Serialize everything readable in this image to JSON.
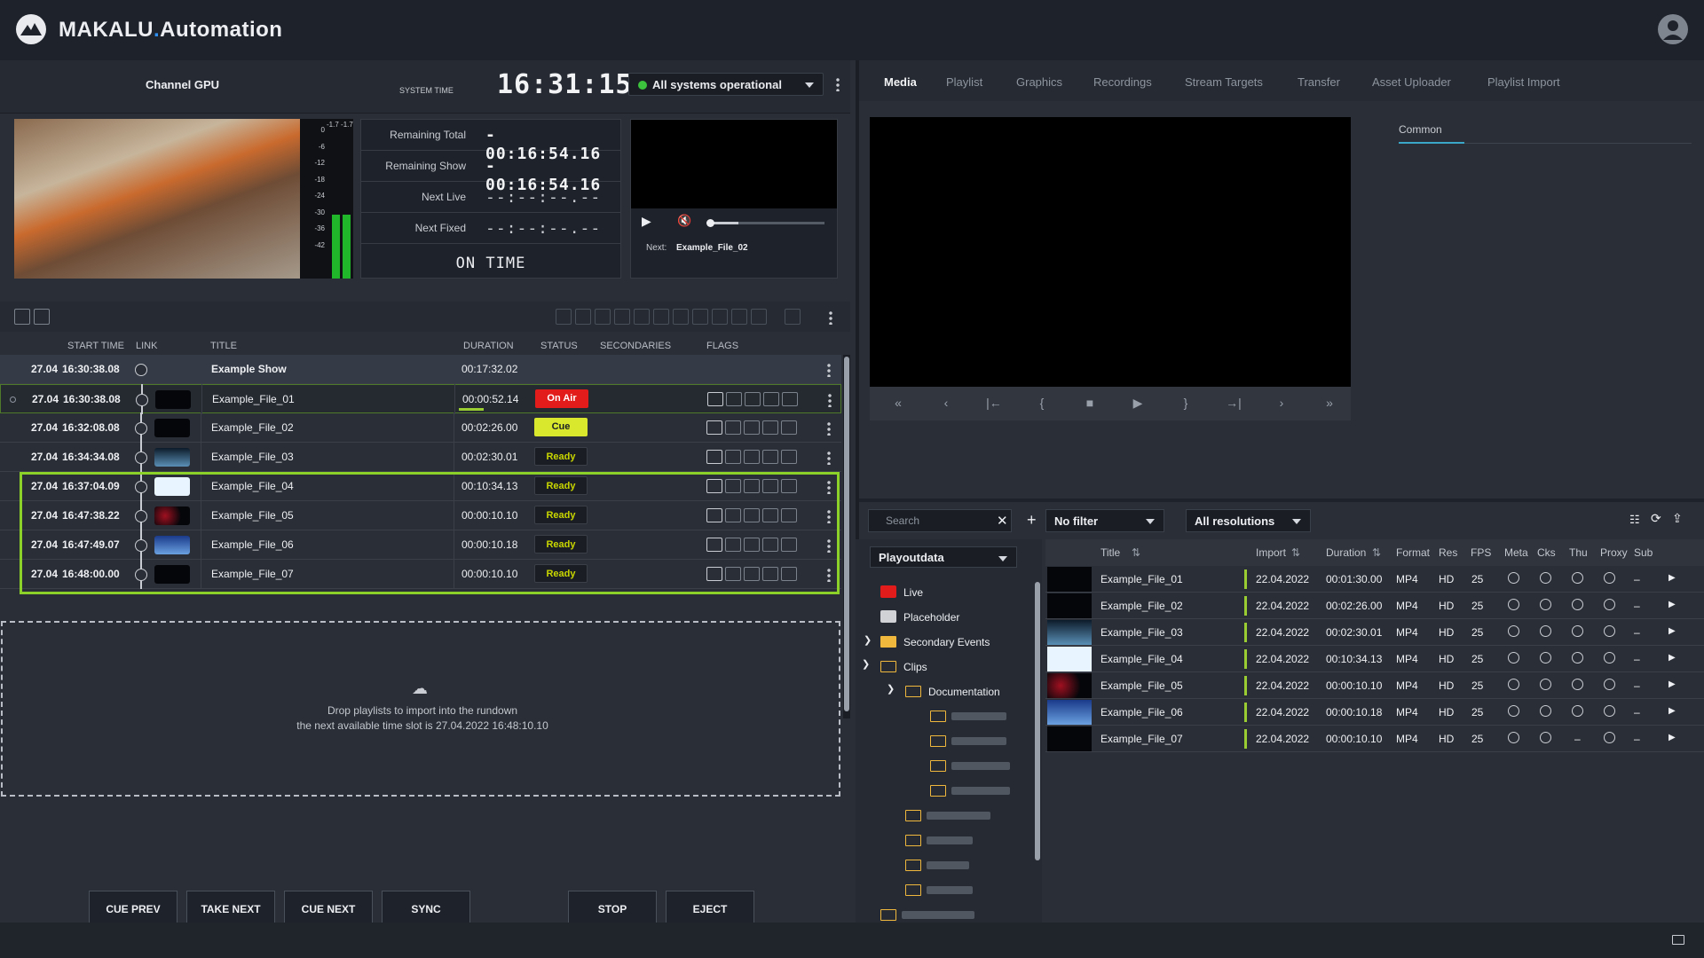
{
  "app": {
    "brand_main": "MAKALU",
    "brand_dot": ".",
    "brand_sub": "Automation"
  },
  "channel": {
    "name": "Channel GPU",
    "system_time_label": "SYSTEM TIME",
    "clock": "16:31:15",
    "status": "All systems operational",
    "status_color": "#3cc23c"
  },
  "vu": {
    "ticks": [
      "0",
      "-6",
      "-12",
      "-18",
      "-24",
      "-30",
      "-36",
      "-42"
    ],
    "peak_labels": [
      "-1.7",
      "-1.7"
    ],
    "levels": [
      0.4,
      0.4
    ]
  },
  "timers": {
    "rows": [
      {
        "label": "Remaining Total",
        "value": "- 00:16:54.16"
      },
      {
        "label": "Remaining Show",
        "value": "- 00:16:54.16"
      },
      {
        "label": "Next Live",
        "value": "--:--:--.--"
      },
      {
        "label": "Next Fixed",
        "value": "--:--:--.--"
      }
    ],
    "state": "ON TIME"
  },
  "preview": {
    "next_label": "Next:",
    "next_value": "Example_File_02",
    "progress": 0.25
  },
  "rundown": {
    "headers": {
      "start": "START TIME",
      "link": "LINK",
      "title": "TITLE",
      "duration": "DURATION",
      "status": "STATUS",
      "secondaries": "SECONDARIES",
      "flags": "FLAGS"
    },
    "show": {
      "date": "27.04",
      "time": "16:30:38.08",
      "title": "Example Show",
      "duration": "00:17:32.02"
    },
    "items": [
      {
        "date": "27.04",
        "time": "16:30:38.08",
        "title": "Example_File_01",
        "duration": "00:00:52.14",
        "status": "On Air",
        "kind": "onair"
      },
      {
        "date": "27.04",
        "time": "16:32:08.08",
        "title": "Example_File_02",
        "duration": "00:02:26.00",
        "status": "Cue",
        "kind": "cue"
      },
      {
        "date": "27.04",
        "time": "16:34:34.08",
        "title": "Example_File_03",
        "duration": "00:02:30.01",
        "status": "Ready",
        "kind": "ready"
      },
      {
        "date": "27.04",
        "time": "16:37:04.09",
        "title": "Example_File_04",
        "duration": "00:10:34.13",
        "status": "Ready",
        "kind": "ready"
      },
      {
        "date": "27.04",
        "time": "16:47:38.22",
        "title": "Example_File_05",
        "duration": "00:00:10.10",
        "status": "Ready",
        "kind": "ready"
      },
      {
        "date": "27.04",
        "time": "16:47:49.07",
        "title": "Example_File_06",
        "duration": "00:00:10.18",
        "status": "Ready",
        "kind": "ready"
      },
      {
        "date": "27.04",
        "time": "16:48:00.00",
        "title": "Example_File_07",
        "duration": "00:00:10.10",
        "status": "Ready",
        "kind": "ready"
      }
    ],
    "drop_line1": "Drop playlists to import into the rundown",
    "drop_line2": "the next available time slot is 27.04.2022 16:48:10.10"
  },
  "controls": [
    {
      "label": "CUE PREV",
      "icon": "|◀"
    },
    {
      "label": "TAKE NEXT",
      "icon": "▶"
    },
    {
      "label": "CUE NEXT",
      "icon": "▶|"
    },
    {
      "label": "SYNC",
      "icon": "⟳"
    },
    {
      "label": "STOP",
      "icon": "■"
    },
    {
      "label": "EJECT",
      "icon": "⏏"
    }
  ],
  "tabs": [
    "Media",
    "Playlist",
    "Graphics",
    "Recordings",
    "Stream Targets",
    "Transfer",
    "Asset Uploader",
    "Playlist Import"
  ],
  "player_controls": [
    "«",
    "‹",
    "|←",
    "{",
    "■",
    "▶",
    "}",
    "→|",
    "›",
    "»"
  ],
  "inspector": {
    "tab": "Common"
  },
  "media": {
    "search_placeholder": "Search",
    "filter": "No filter",
    "resolution": "All resolutions",
    "source": "Playoutdata",
    "tree": {
      "live": "Live",
      "placeholder": "Placeholder",
      "secondary": "Secondary Events",
      "clips": "Clips",
      "documentation": "Documentation"
    },
    "headers": {
      "title": "Title",
      "import": "Import",
      "duration": "Duration",
      "format": "Format",
      "res": "Res",
      "fps": "FPS",
      "meta": "Meta",
      "cks": "Cks",
      "thu": "Thu",
      "proxy": "Proxy",
      "sub": "Sub"
    },
    "rows": [
      {
        "title": "Example_File_01",
        "import": "22.04.2022",
        "duration": "00:01:30.00",
        "format": "MP4",
        "res": "HD",
        "fps": "25",
        "thu": true
      },
      {
        "title": "Example_File_02",
        "import": "22.04.2022",
        "duration": "00:02:26.00",
        "format": "MP4",
        "res": "HD",
        "fps": "25",
        "thu": true
      },
      {
        "title": "Example_File_03",
        "import": "22.04.2022",
        "duration": "00:02:30.01",
        "format": "MP4",
        "res": "HD",
        "fps": "25",
        "thu": true
      },
      {
        "title": "Example_File_04",
        "import": "22.04.2022",
        "duration": "00:10:34.13",
        "format": "MP4",
        "res": "HD",
        "fps": "25",
        "thu": true
      },
      {
        "title": "Example_File_05",
        "import": "22.04.2022",
        "duration": "00:00:10.10",
        "format": "MP4",
        "res": "HD",
        "fps": "25",
        "thu": true
      },
      {
        "title": "Example_File_06",
        "import": "22.04.2022",
        "duration": "00:00:10.18",
        "format": "MP4",
        "res": "HD",
        "fps": "25",
        "thu": true
      },
      {
        "title": "Example_File_07",
        "import": "22.04.2022",
        "duration": "00:00:10.10",
        "format": "MP4",
        "res": "HD",
        "fps": "25",
        "thu": false
      }
    ],
    "sub_value": "–",
    "thu_missing": "–"
  }
}
